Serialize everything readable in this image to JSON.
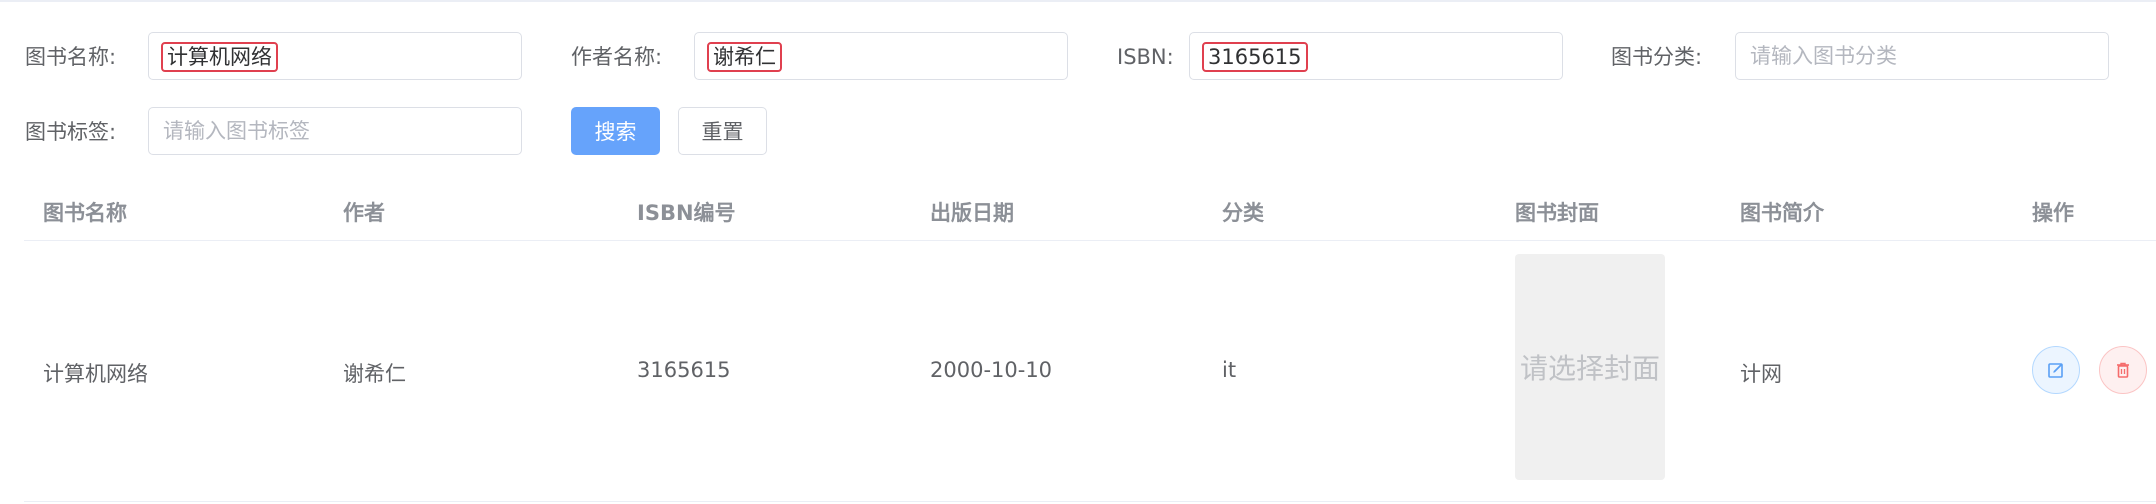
{
  "search": {
    "book_name_label": "图书名称:",
    "book_name_value": "计算机网络",
    "author_label": "作者名称:",
    "author_value": "谢希仁",
    "isbn_label": "ISBN:",
    "isbn_value": "3165615",
    "category_label": "图书分类:",
    "category_placeholder": "请输入图书分类",
    "tag_label": "图书标签:",
    "tag_placeholder": "请输入图书标签",
    "search_button": "搜索",
    "reset_button": "重置"
  },
  "table": {
    "columns": [
      "图书名称",
      "作者",
      "ISBN编号",
      "出版日期",
      "分类",
      "图书封面",
      "图书简介",
      "操作"
    ],
    "rows": [
      {
        "name": "计算机网络",
        "author": "谢希仁",
        "isbn": "3165615",
        "date": "2000-10-10",
        "category": "it",
        "cover_placeholder": "请选择封面",
        "intro": "计网",
        "actions": [
          "edit-icon",
          "trash-icon"
        ]
      }
    ]
  },
  "colors": {
    "primary": "#66a3fb",
    "highlight": "#e0404f",
    "danger": "#f56c6c"
  }
}
